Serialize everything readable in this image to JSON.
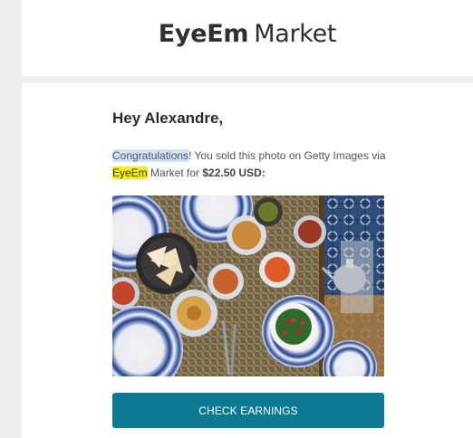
{
  "header": {
    "logo_brand": "EyeEm",
    "logo_product": "Market"
  },
  "email": {
    "greeting": "Hey Alexandre,",
    "message_highlight": "Congratulations",
    "message_part1": "! You sold this photo on Getty Images via",
    "message_brand": "EyeEm",
    "message_part2": " Market for ",
    "message_price": "$22.50 USD:",
    "photo_alt": "Mezze spread on patterned plates",
    "cta_label": "CHECK EARNINGS"
  },
  "colors": {
    "cta_background": "#0d7a94",
    "highlight_blue": "#cfe3fb",
    "highlight_yellow": "#f7f200"
  }
}
